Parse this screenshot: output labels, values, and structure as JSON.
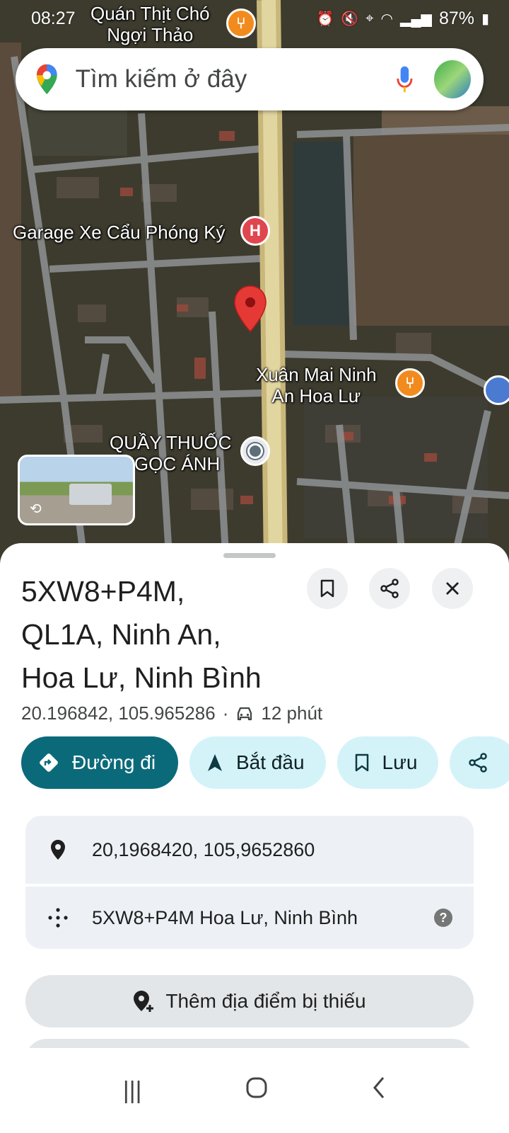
{
  "status_bar": {
    "time": "08:27",
    "battery": "87%"
  },
  "search": {
    "placeholder": "Tìm kiếm ở đây"
  },
  "map": {
    "labels": {
      "restaurant_top": "Quán Thịt Chó\nNgợi Thảo",
      "garage": "Garage Xe Cẩu Phóng Ký",
      "restaurant_right": "Xuân Mai Ninh\nAn Hoa Lư",
      "pharmacy": "QUẦY THUỐC\nNGỌC ÁNH"
    },
    "icons": {
      "restaurant": "fork-knife-icon",
      "hospital": "hospital-icon",
      "shop": "shopping-icon",
      "pin": "map-pin-icon"
    },
    "colors": {
      "pin": "#e53935",
      "road": "#d6c27a",
      "food": "#f28b1e",
      "hospital": "#e0464e"
    }
  },
  "place": {
    "title": "5XW8+P4M,\nQL1A, Ninh An,\nHoa Lư, Ninh Bình",
    "coordinates": "20.196842, 105.965286",
    "separator": "·",
    "drive_time": "12 phút"
  },
  "actions": {
    "directions": "Đường đi",
    "start": "Bắt đầu",
    "save": "Lưu"
  },
  "info": {
    "coordinates_row": "20,1968420, 105,9652860",
    "plus_code_row": "5XW8+P4M Hoa Lư, Ninh Bình"
  },
  "add_missing_place": "Thêm địa điểm bị thiếu",
  "theme": {
    "primary": "#0b6a7a",
    "tonal": "#d3f3f9",
    "card": "#edf1f5"
  }
}
